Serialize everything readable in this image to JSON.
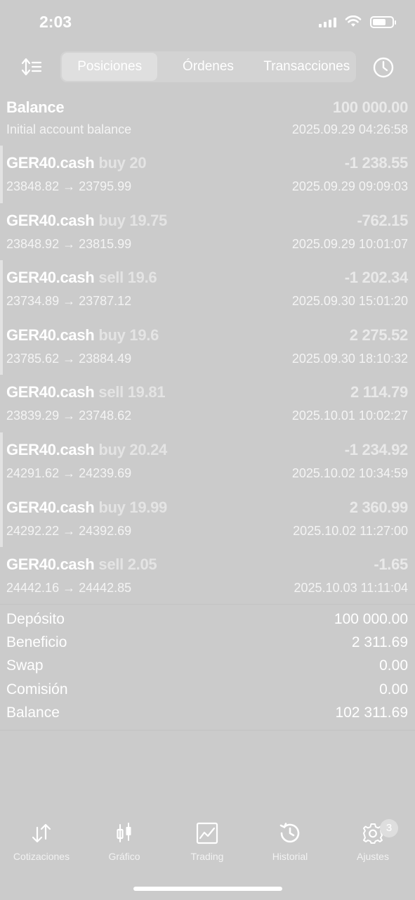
{
  "status_bar": {
    "time": "2:03",
    "battery_level": 0.7
  },
  "toolbar": {
    "tabs": [
      {
        "label": "Posiciones",
        "active": true
      },
      {
        "label": "Órdenes",
        "active": false
      },
      {
        "label": "Transacciones",
        "active": false
      }
    ],
    "sort_icon": "sort-icon",
    "history_icon": "clock-icon"
  },
  "balance_entry": {
    "title": "Balance",
    "amount": "100 000.00",
    "subtitle": "Initial account balance",
    "date": "2025.09.29 04:26:58"
  },
  "trades": [
    {
      "symbol": "GER40.cash",
      "side": "buy 20",
      "profit": "-1 238.55",
      "prices": "23848.82 → 23795.99",
      "date": "2025.09.29 09:09:03",
      "marker": true
    },
    {
      "symbol": "GER40.cash",
      "side": "buy 19.75",
      "profit": "-762.15",
      "prices": "23848.92 → 23815.99",
      "date": "2025.09.29 10:01:07",
      "marker": false
    },
    {
      "symbol": "GER40.cash",
      "side": "sell 19.6",
      "profit": "-1 202.34",
      "prices": "23734.89 → 23787.12",
      "date": "2025.09.30 15:01:20",
      "marker": true
    },
    {
      "symbol": "GER40.cash",
      "side": "buy 19.6",
      "profit": "2 275.52",
      "prices": "23785.62 → 23884.49",
      "date": "2025.09.30 18:10:32",
      "marker": true
    },
    {
      "symbol": "GER40.cash",
      "side": "sell 19.81",
      "profit": "2 114.79",
      "prices": "23839.29 → 23748.62",
      "date": "2025.10.01 10:02:27",
      "marker": false
    },
    {
      "symbol": "GER40.cash",
      "side": "buy 20.24",
      "profit": "-1 234.92",
      "prices": "24291.62 → 24239.69",
      "date": "2025.10.02 10:34:59",
      "marker": true
    },
    {
      "symbol": "GER40.cash",
      "side": "buy 19.99",
      "profit": "2 360.99",
      "prices": "24292.22 → 24392.69",
      "date": "2025.10.02 11:27:00",
      "marker": true
    },
    {
      "symbol": "GER40.cash",
      "side": "sell 2.05",
      "profit": "-1.65",
      "prices": "24442.16 → 24442.85",
      "date": "2025.10.03 11:11:04",
      "marker": false
    }
  ],
  "summary": [
    {
      "label": "Depósito",
      "value": "100 000.00"
    },
    {
      "label": "Beneficio",
      "value": "2 311.69"
    },
    {
      "label": "Swap",
      "value": "0.00"
    },
    {
      "label": "Comisión",
      "value": "0.00"
    },
    {
      "label": "Balance",
      "value": "102 311.69"
    }
  ],
  "tabbar": {
    "items": [
      {
        "label": "Cotizaciones",
        "icon": "quotes-icon"
      },
      {
        "label": "Gráfico",
        "icon": "candlestick-icon"
      },
      {
        "label": "Trading",
        "icon": "trading-chart-icon"
      },
      {
        "label": "Historial",
        "icon": "history-icon"
      },
      {
        "label": "Ajustes",
        "icon": "settings-gear-icon"
      }
    ],
    "badge": "3"
  }
}
